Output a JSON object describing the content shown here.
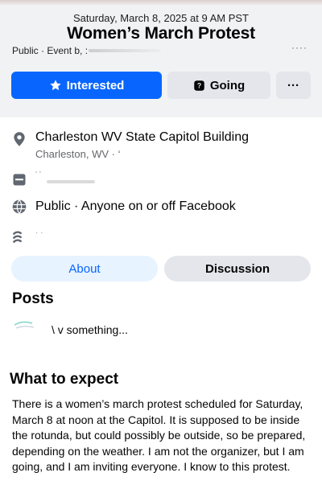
{
  "header": {
    "date": "Saturday, March 8, 2025 at 9 AM PST",
    "title": "Women’s March Protest",
    "meta": "Public · Event b, :",
    "more_dots": "····"
  },
  "actions": {
    "interested_label": "Interested",
    "going_label": "Going",
    "more_label": "···"
  },
  "details": {
    "location_name": "Charleston WV State Capitol Building",
    "location_sub": "Charleston, WV · ‘",
    "row2_text": "' ’",
    "privacy": "Public · Anyone on or off Facebook",
    "row4_text": "·  ·"
  },
  "tabs": {
    "about": "About",
    "discussion": "Discussion"
  },
  "posts": {
    "title": "Posts",
    "write_prompt": "\\ v something..."
  },
  "expect": {
    "title": "What to expect",
    "body": "There is a women’s march protest scheduled for Saturday, March 8 at noon at the Capitol.  It is supposed to be inside the rotunda, but could possibly be outside, so be prepared, depending on the weather. I am not the organizer, but I am going, and I am inviting everyone. I know to this protest."
  },
  "colors": {
    "accent": "#0866ff",
    "button_grey": "#e4e6eb",
    "header_bg": "#f1f2f4",
    "tab_about_bg": "#e7f3ff"
  },
  "icons": {
    "interested": "star-icon",
    "going": "question-icon",
    "location": "map-pin-icon",
    "privacy": "globe-icon"
  }
}
